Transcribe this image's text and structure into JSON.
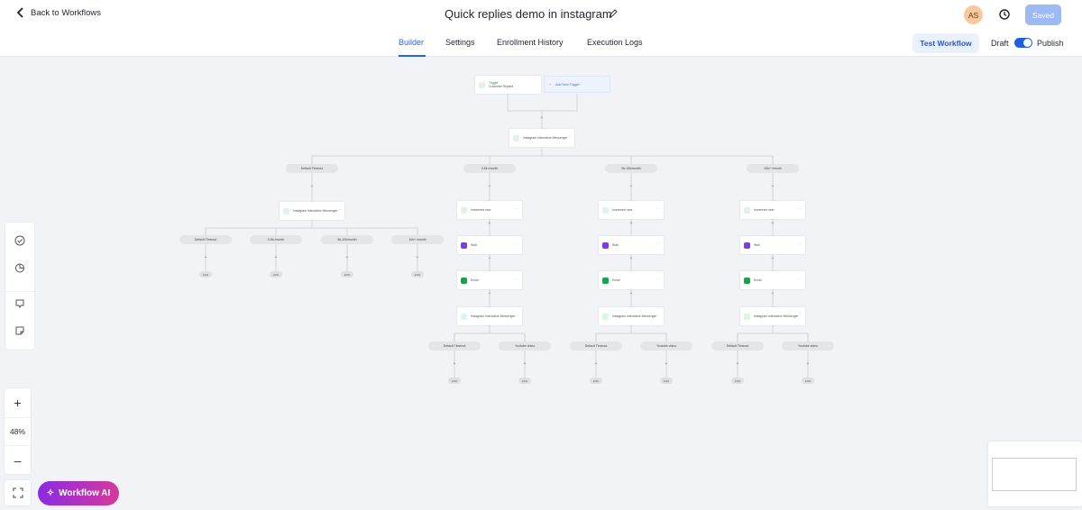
{
  "header": {
    "back_label": "Back to Workflows",
    "title": "Quick replies demo in instagram",
    "avatar_initials": "AS",
    "saved_label": "Saved"
  },
  "tabs": [
    {
      "label": "Builder",
      "active": true
    },
    {
      "label": "Settings",
      "active": false
    },
    {
      "label": "Enrollment History",
      "active": false
    },
    {
      "label": "Execution Logs",
      "active": false
    }
  ],
  "actions": {
    "test_workflow": "Test Workflow",
    "draft": "Draft",
    "publish": "Publish",
    "publish_on": true
  },
  "workflow": {
    "trigger": {
      "title": "Trigger",
      "subtitle": "Customer Replied"
    },
    "add_trigger": "Add New Trigger",
    "root_action": "Instagram Interactive Messenger",
    "branches": [
      {
        "label": "Default Timeout",
        "action": "Instagram Interactive Messenger",
        "sub_branches": [
          "Default Timeout",
          "0-5k /month",
          "5k-10k/month",
          "10k+ /month"
        ]
      },
      {
        "label": "0-5k /month",
        "steps": [
          "Increment user",
          "Wait",
          "Email",
          "Instagram Interactive Messenger"
        ],
        "sub_branches": [
          "Default Timeout",
          "Youtube video"
        ]
      },
      {
        "label": "5k-10k/month",
        "steps": [
          "Increment user",
          "Wait",
          "Email",
          "Instagram Interactive Messenger"
        ],
        "sub_branches": [
          "Default Timeout",
          "Youtube video"
        ]
      },
      {
        "label": "10k+ /month",
        "steps": [
          "Increment user",
          "Wait",
          "Email",
          "Instagram Interactive Messenger"
        ],
        "sub_branches": [
          "Default Timeout",
          "Youtube video"
        ]
      }
    ],
    "end_label": "END"
  },
  "canvas": {
    "zoom": "48%",
    "ai_button": "Workflow AI"
  },
  "colors": {
    "accent": "#2563eb",
    "instagram": "#2fae6f",
    "wait": "#7c3aed",
    "email": "#16a34a"
  }
}
